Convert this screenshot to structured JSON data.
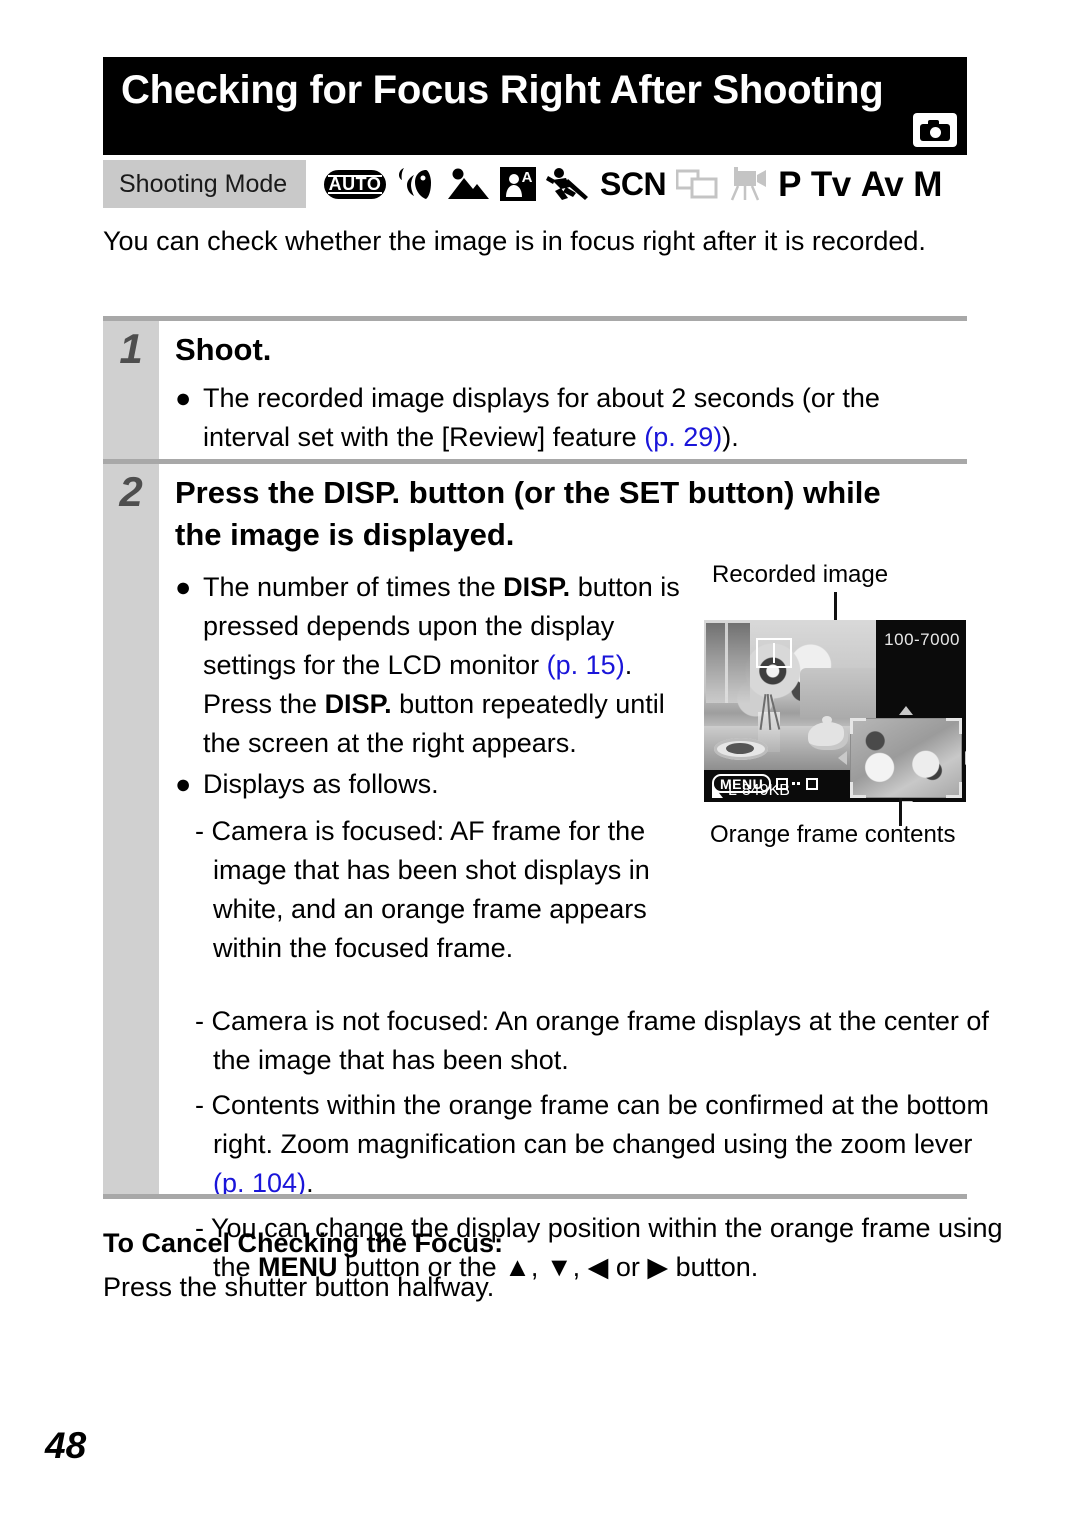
{
  "header": {
    "title": "Checking for Focus Right After Shooting",
    "camera_icon": "camera-icon"
  },
  "shooting_mode": {
    "label": "Shooting Mode",
    "modes": [
      {
        "name": "auto-mode-icon",
        "label": "AUTO"
      },
      {
        "name": "portrait-mode-icon",
        "label": ""
      },
      {
        "name": "landscape-mode-icon",
        "label": ""
      },
      {
        "name": "night-snapshot-mode-icon",
        "label": "A"
      },
      {
        "name": "kids-and-pets-mode-icon",
        "label": ""
      },
      {
        "name": "scene-mode-icon",
        "label": "SCN"
      },
      {
        "name": "stitch-assist-mode-icon",
        "label": ""
      },
      {
        "name": "movie-mode-icon",
        "label": ""
      },
      {
        "name": "program-mode-icon",
        "label": "P"
      },
      {
        "name": "shutter-priority-mode-icon",
        "label": "Tv"
      },
      {
        "name": "aperture-priority-mode-icon",
        "label": "Av"
      },
      {
        "name": "manual-mode-icon",
        "label": "M"
      }
    ]
  },
  "intro": "You can check whether the image is in focus right after it is recorded.",
  "steps": [
    {
      "number": "1",
      "heading": "Shoot.",
      "bullets": [
        {
          "parts": [
            {
              "t": "The recorded image displays for about 2 seconds (or the interval set with the [Review] feature "
            },
            {
              "t": "(p. 29)",
              "style": "blue"
            },
            {
              "t": ")."
            }
          ]
        }
      ]
    },
    {
      "number": "2",
      "heading_parts": [
        {
          "t": "Press the "
        },
        {
          "t": "DISP.",
          "style": "bold"
        },
        {
          "t": " button (or the "
        },
        {
          "t": "SET",
          "style": "bold"
        },
        {
          "t": " button) while the image is displayed."
        }
      ],
      "bullets": [
        {
          "parts": [
            {
              "t": "The number of times the "
            },
            {
              "t": "DISP.",
              "style": "bold"
            },
            {
              "t": " button is pressed depends upon the display settings for the LCD monitor "
            },
            {
              "t": "(p. 15)",
              "style": "blue"
            },
            {
              "t": ". Press the "
            },
            {
              "t": "DISP.",
              "style": "bold"
            },
            {
              "t": " button repeatedly until the screen at the right appears."
            }
          ]
        },
        {
          "parts": [
            {
              "t": "Displays as follows."
            }
          ]
        }
      ],
      "sub_items": [
        {
          "parts": [
            {
              "t": "- Camera is focused: AF frame for the image that has been shot displays in white, and an orange frame appears within the focused frame."
            }
          ]
        },
        {
          "parts": [
            {
              "t": "- Camera is not focused: An orange frame displays at the center of the image that has been shot."
            }
          ]
        },
        {
          "parts": [
            {
              "t": "- Contents within the orange frame can be confirmed at the bottom right. Zoom magnification can be changed using the zoom lever "
            },
            {
              "t": "(p. 104)",
              "style": "blue"
            },
            {
              "t": "."
            }
          ]
        },
        {
          "parts": [
            {
              "t": "- You can change the display position within the orange frame using the "
            },
            {
              "t": "MENU",
              "style": "bold"
            },
            {
              "t": " button or the ▲, ▼, ◀ or ▶ button."
            }
          ]
        }
      ]
    }
  ],
  "figure": {
    "top_caption": "Recorded image",
    "bottom_caption": "Orange frame contents",
    "lcd": {
      "file_number": "100-7000",
      "menu_badge": "MENU",
      "swap_icon": "swap-display-icon",
      "quality_icon": "fine-quality-icon",
      "image_size": "L",
      "file_size": "849KB",
      "af_frame": "af-frame-icon",
      "inset": "magnified-inset"
    }
  },
  "cancel_section": {
    "title": "To Cancel Checking the Focus:",
    "text": "Press the shutter button halfway."
  },
  "page_number": "48",
  "colors": {
    "header_bg": "#000000",
    "mode_label_bg": "#c9c9c9",
    "step_col_bg": "#d0d0d0",
    "rule": "#a8a8a8",
    "link_blue": "#1a15d9"
  }
}
